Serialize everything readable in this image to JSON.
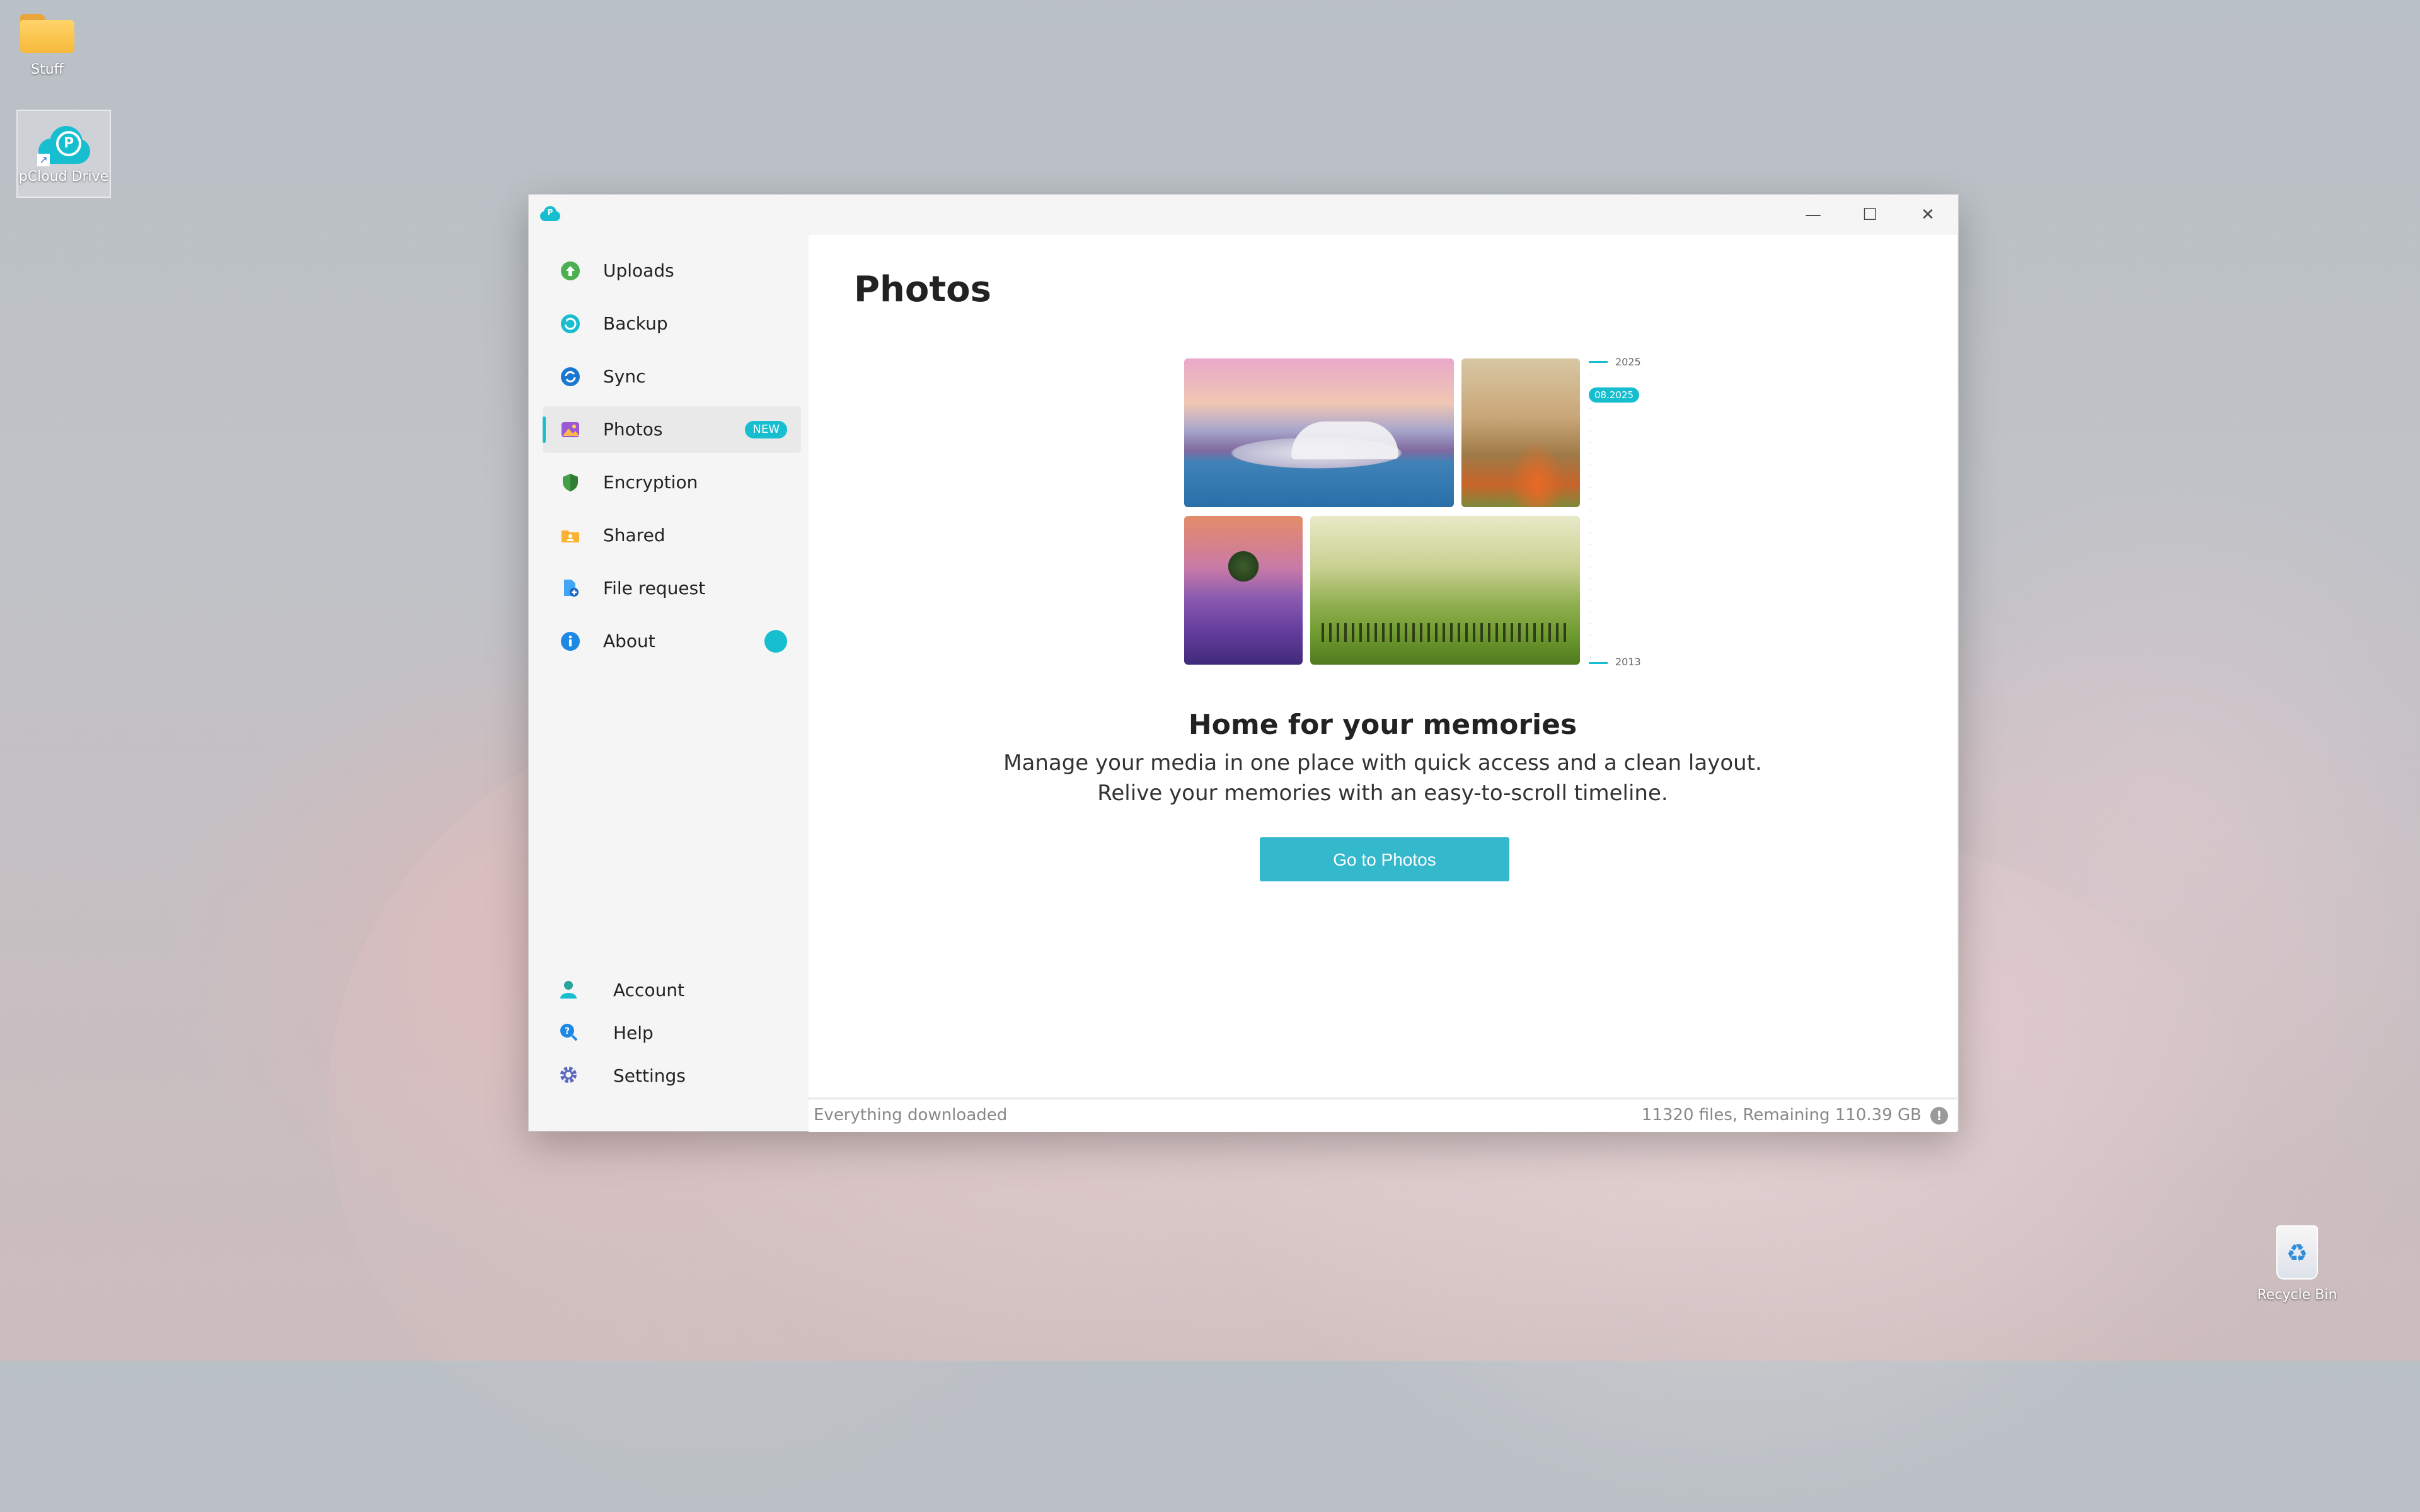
{
  "desktop": {
    "icons": [
      {
        "label": "Stuff"
      },
      {
        "label": "pCloud Drive"
      },
      {
        "label": "Recycle Bin"
      }
    ]
  },
  "window": {
    "controls": {
      "minimize": "—",
      "maximize": "☐",
      "close": "✕"
    }
  },
  "sidebar": {
    "items": [
      {
        "label": "Uploads",
        "icon": "upload-icon"
      },
      {
        "label": "Backup",
        "icon": "backup-icon"
      },
      {
        "label": "Sync",
        "icon": "sync-icon"
      },
      {
        "label": "Photos",
        "icon": "photos-icon",
        "badge": "NEW",
        "active": true
      },
      {
        "label": "Encryption",
        "icon": "shield-icon"
      },
      {
        "label": "Shared",
        "icon": "shared-folder-icon"
      },
      {
        "label": "File request",
        "icon": "file-request-icon"
      },
      {
        "label": "About",
        "icon": "info-icon"
      }
    ],
    "bottom": [
      {
        "label": "Account",
        "icon": "user-icon"
      },
      {
        "label": "Help",
        "icon": "help-icon"
      },
      {
        "label": "Settings",
        "icon": "gear-icon"
      }
    ]
  },
  "main": {
    "title": "Photos",
    "timeline": {
      "top": "2025",
      "current": "08.2025",
      "bottom": "2013"
    },
    "headline": "Home for your memories",
    "description": "Manage your media in one place with quick access and a clean layout. Relive your memories with an easy-to-scroll timeline.",
    "cta": "Go to Photos"
  },
  "status": {
    "left": "Everything downloaded",
    "right": "11320 files, Remaining 110.39 GB",
    "info": "!"
  },
  "colors": {
    "accent": "#17bed0",
    "button": "#34b8cc"
  }
}
